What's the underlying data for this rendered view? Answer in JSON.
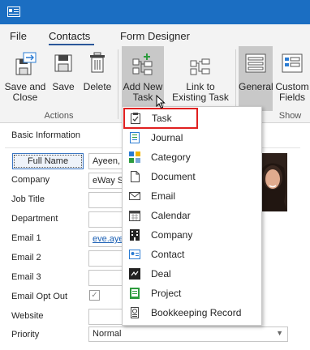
{
  "menu": {
    "tabs": [
      {
        "label": "File"
      },
      {
        "label": "Contacts"
      },
      {
        "label": "Form Designer"
      }
    ]
  },
  "ribbon": {
    "buttons": {
      "save_close": "Save and\nClose",
      "save": "Save",
      "delete": "Delete",
      "add_new": "Add New\nTask",
      "link": "Link to\nExisting Task",
      "general": "General",
      "custom": "Custom\nFields"
    },
    "groups": {
      "actions": "Actions",
      "show": "Show"
    }
  },
  "form": {
    "section": "Basic Information",
    "full_name_button": "Full Name",
    "full_name_value": "Ayeen, ",
    "fields": [
      {
        "label": "Company",
        "value": "eWay S"
      },
      {
        "label": "Job Title",
        "value": ""
      },
      {
        "label": "Department",
        "value": ""
      },
      {
        "label": "Email 1",
        "value": "eve.ayee"
      },
      {
        "label": "Email 2",
        "value": ""
      },
      {
        "label": "Email 3",
        "value": ""
      },
      {
        "label": "Email Opt Out",
        "value": ""
      },
      {
        "label": "Website",
        "value": ""
      },
      {
        "label": "Priority",
        "value": "Normal"
      }
    ],
    "email_opt_out_checked": true
  },
  "dropdown": {
    "items": [
      {
        "label": "Task",
        "icon": "task-icon"
      },
      {
        "label": "Journal",
        "icon": "journal-icon"
      },
      {
        "label": "Category",
        "icon": "category-icon"
      },
      {
        "label": "Document",
        "icon": "document-icon"
      },
      {
        "label": "Email",
        "icon": "email-icon"
      },
      {
        "label": "Calendar",
        "icon": "calendar-icon"
      },
      {
        "label": "Company",
        "icon": "company-icon"
      },
      {
        "label": "Contact",
        "icon": "contact-icon"
      },
      {
        "label": "Deal",
        "icon": "deal-icon"
      },
      {
        "label": "Project",
        "icon": "project-icon"
      },
      {
        "label": "Bookkeeping Record",
        "icon": "bookkeeping-icon"
      }
    ],
    "highlighted": "Task"
  },
  "colors": {
    "titlebar": "#1b6ec2",
    "highlight_border": "#e02020",
    "accent": "#2b579a"
  }
}
